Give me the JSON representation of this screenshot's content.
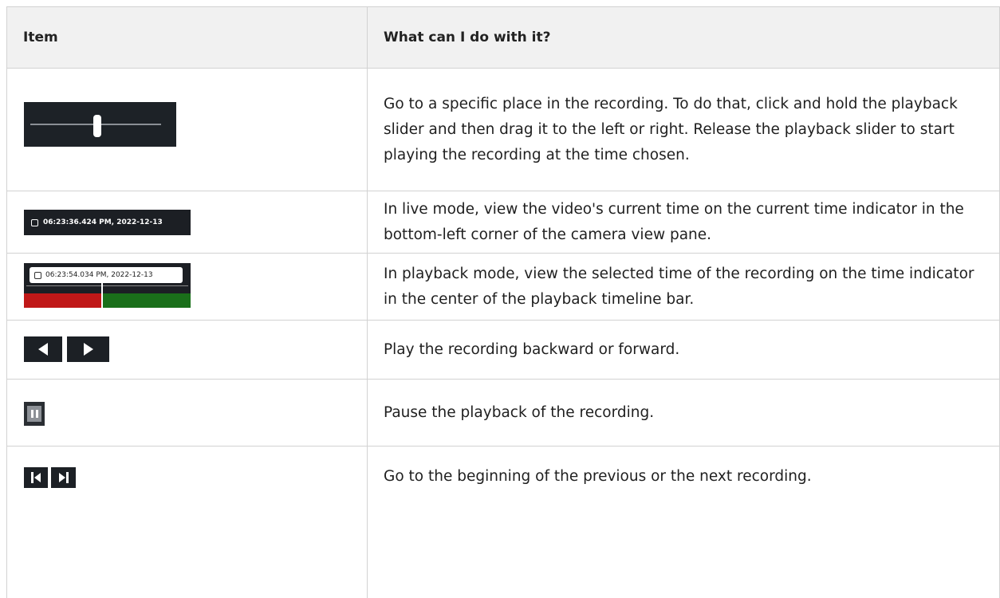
{
  "table": {
    "headers": {
      "item": "Item",
      "description": "What can I do with it?"
    },
    "rows": [
      {
        "icon": "playback-slider",
        "description": "Go to a specific place in the recording. To do that, click and hold the playback slider and then drag it to the left or right. Release the playback slider to start playing the recording at the time chosen."
      },
      {
        "icon": "live-time-indicator",
        "time": "06:23:36.424 PM, 2022-12-13",
        "description": "In live mode, view the video's current time on the current time indicator in the bottom-left corner of the camera view pane."
      },
      {
        "icon": "playback-time-indicator",
        "time": "06:23:54.034 PM, 2022-12-13",
        "description": "In playback mode, view the selected time of the recording on the time indicator in the center of the playback timeline bar."
      },
      {
        "icon": "play-backward-forward-buttons",
        "description": "Play the recording backward or forward."
      },
      {
        "icon": "pause-button",
        "description": "Pause the playback of the recording."
      },
      {
        "icon": "previous-next-recording-buttons",
        "description": "Go to the beginning of the previous or the next recording."
      }
    ]
  },
  "colors": {
    "timeline_red": "#c01818",
    "timeline_green": "#1a6f1a",
    "header_bg": "#f1f1f1",
    "icon_bg": "#1c2025"
  }
}
